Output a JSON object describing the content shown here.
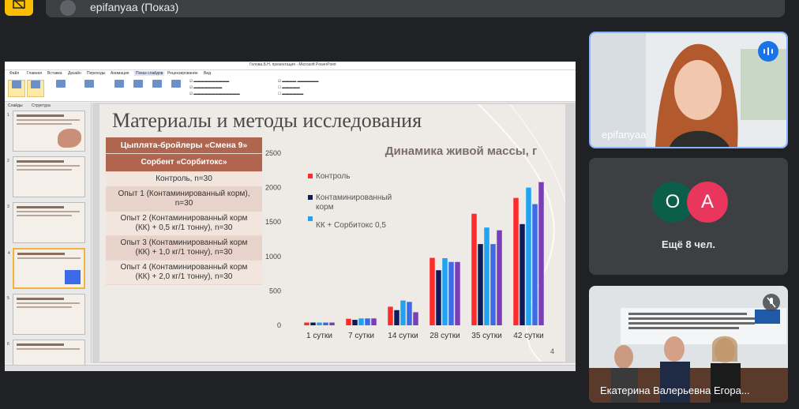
{
  "presenter_bar": {
    "label": "epifanyaa (Показ)"
  },
  "powerpoint": {
    "window_title": "Голова.Б.Н. презентация - Microsoft PowerPoint",
    "tabs": [
      "Файл",
      "Главная",
      "Вставка",
      "Дизайн",
      "Переходы",
      "Анимация",
      "Показ слайдов",
      "Рецензирование",
      "Вид"
    ],
    "panel_tabs": [
      "Слайды",
      "Структура"
    ]
  },
  "slide": {
    "title": "Материалы и методы исследования",
    "page_number": "4",
    "table": {
      "header": "Цыплята-бройлеры «Смена 9»",
      "sorbent_header": "Сорбент «Сорбитокс»",
      "rows": [
        "Контроль, n=30",
        "Опыт 1 (Контаминированный корм), n=30",
        "Опыт 2 (Контаминированный корм (КК) + 0,5 кг/1 тонну), n=30",
        "Опыт 3 (Контаминированный корм (КК) + 1,0 кг/1 тонну), n=30",
        "Опыт 4 (Контаминированный корм (КК) + 2,0 кг/1 тонну), n=30"
      ]
    }
  },
  "chart_data": {
    "type": "bar",
    "title": "Динамика живой массы, г",
    "categories": [
      "1 сутки",
      "7 сутки",
      "14 сутки",
      "28 сутки",
      "35 сутки",
      "42 сутки"
    ],
    "ylim": [
      0,
      2500
    ],
    "yticks": [
      0,
      500,
      1000,
      1500,
      2000,
      2500
    ],
    "legend": [
      "Контроль",
      "Контаминированный корм",
      "КК + Сорбитокс 0,5"
    ],
    "series": [
      {
        "name": "Контроль",
        "color": "#ff2a2a",
        "values": [
          40,
          95,
          270,
          980,
          1620,
          1850
        ]
      },
      {
        "name": "Контаминированный корм",
        "color": "#0f1c5c",
        "values": [
          40,
          80,
          220,
          800,
          1180,
          1470
        ]
      },
      {
        "name": "КК + Сорбитокс 0,5",
        "color": "#1fa3f2",
        "values": [
          40,
          100,
          360,
          975,
          1420,
          2000
        ]
      },
      {
        "color": "#3d6be8",
        "values": [
          40,
          100,
          340,
          920,
          1180,
          1760
        ]
      },
      {
        "color": "#7a3fb8",
        "values": [
          40,
          100,
          190,
          920,
          1380,
          2080
        ]
      }
    ]
  },
  "participants": {
    "main": {
      "name": "epifanyaa"
    },
    "group": {
      "avatars": [
        "О",
        "А"
      ],
      "more": "Ещё 8 чел."
    },
    "room": {
      "name": "Екатерина Валерьевна Егора..."
    }
  }
}
